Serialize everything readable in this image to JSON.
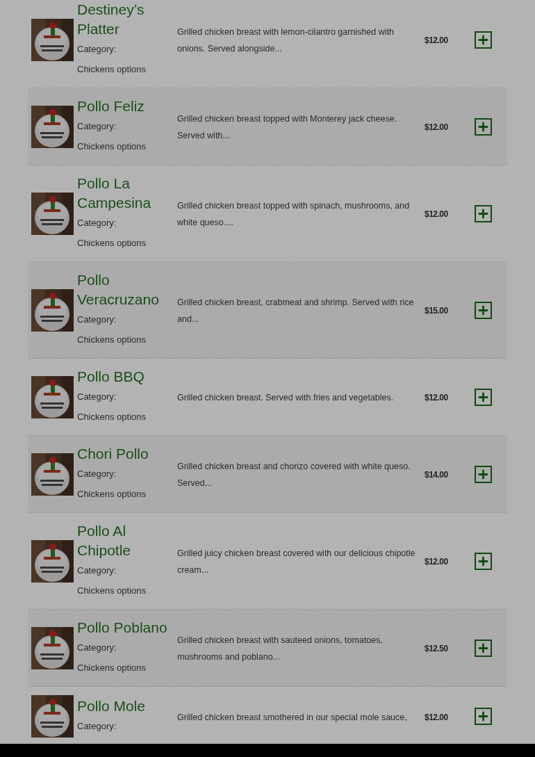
{
  "items": [
    {
      "name": "Destiney’s Platter",
      "category_label": "Category:",
      "category": "Chickens options",
      "description": "Grilled chicken breast with lemon-cilantro garnished with onions. Served alongside...",
      "price": "$12.00"
    },
    {
      "name": "Pollo Feliz",
      "category_label": "Category:",
      "category": "Chickens options",
      "description": "Grilled chicken breast topped with Monterey jack cheese. Served with...",
      "price": "$12.00"
    },
    {
      "name": "Pollo La Campesina",
      "category_label": "Category:",
      "category": "Chickens options",
      "description": "Grilled chicken breast topped with spinach, mushrooms, and white queso....",
      "price": "$12.00"
    },
    {
      "name": "Pollo Veracruzano",
      "category_label": "Category:",
      "category": "Chickens options",
      "description": "Grilled chicken breast, crabmeat and shrimp. Served with rice and...",
      "price": "$15.00"
    },
    {
      "name": "Pollo BBQ",
      "category_label": "Category:",
      "category": "Chickens options",
      "description": "Grilled chicken breast. Served with fries and vegetables.",
      "price": "$12.00"
    },
    {
      "name": "Chori Pollo",
      "category_label": "Category:",
      "category": "Chickens options",
      "description": "Grilled chicken breast and chorizo covered with white queso. Served...",
      "price": "$14.00"
    },
    {
      "name": "Pollo Al Chipotle",
      "category_label": "Category:",
      "category": "Chickens options",
      "description": "Grilled juicy chicken breast covered with our delicious chipotle cream...",
      "price": "$12.00"
    },
    {
      "name": "Pollo Poblano",
      "category_label": "Category:",
      "category": "Chickens options",
      "description": "Grilled chicken breast with sauteed onions, tomatoes, mushrooms and poblano...",
      "price": "$12.50"
    },
    {
      "name": "Pollo Mole",
      "category_label": "Category:",
      "description": "Grilled chicken breast smothered in our special mole sauce,",
      "price": "$12.00"
    }
  ]
}
